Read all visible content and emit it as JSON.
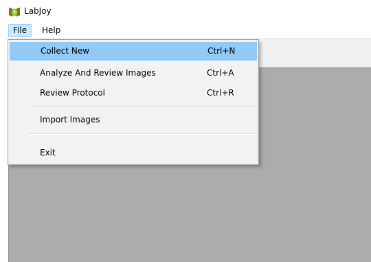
{
  "window": {
    "title": "LabJoy",
    "icon": "labjoy-app-icon"
  },
  "menubar": {
    "items": [
      {
        "label": "File",
        "state": "open"
      },
      {
        "label": "Help"
      }
    ]
  },
  "file_menu": {
    "items": [
      {
        "label": "Collect New",
        "shortcut": "Ctrl+N",
        "highlighted": true
      },
      {
        "label": "Analyze And Review Images",
        "shortcut": "Ctrl+A"
      },
      {
        "label": "Review Protocol",
        "shortcut": "Ctrl+R"
      },
      {
        "label": "Import Images",
        "shortcut": ""
      },
      {
        "label": "Exit",
        "shortcut": ""
      }
    ]
  },
  "colors": {
    "highlight": "#91c9f7",
    "menubar_active": "#cce8ff",
    "workspace": "#ababab",
    "menu_background": "#f2f2f2"
  }
}
